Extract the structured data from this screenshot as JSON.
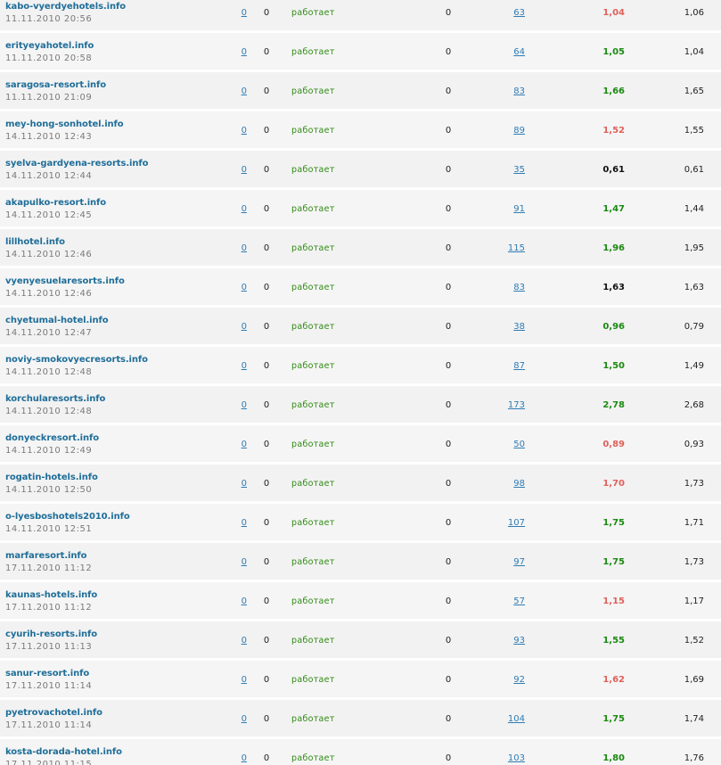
{
  "colors": {
    "green": "#1a8a10",
    "red": "#e0605a",
    "black": "#111111",
    "link": "#2f7cb4",
    "site": "#1f6e99",
    "status": "#2f8a12"
  },
  "rows": [
    {
      "site": "kabo-vyerdyehotels.info",
      "date": "11.11.2010 20:56",
      "links": "0",
      "zero1": "0",
      "status": "работает",
      "zero2": "0",
      "count": "63",
      "ratio": "1,04",
      "ratio_color": "red",
      "ratio2": "1,06"
    },
    {
      "site": "erityeyahotel.info",
      "date": "11.11.2010 20:58",
      "links": "0",
      "zero1": "0",
      "status": "работает",
      "zero2": "0",
      "count": "64",
      "ratio": "1,05",
      "ratio_color": "green",
      "ratio2": "1,04"
    },
    {
      "site": "saragosa-resort.info",
      "date": "11.11.2010 21:09",
      "links": "0",
      "zero1": "0",
      "status": "работает",
      "zero2": "0",
      "count": "83",
      "ratio": "1,66",
      "ratio_color": "green",
      "ratio2": "1,65"
    },
    {
      "site": "mey-hong-sonhotel.info",
      "date": "14.11.2010 12:43",
      "links": "0",
      "zero1": "0",
      "status": "работает",
      "zero2": "0",
      "count": "89",
      "ratio": "1,52",
      "ratio_color": "red",
      "ratio2": "1,55"
    },
    {
      "site": "syelva-gardyena-resorts.info",
      "date": "14.11.2010 12:44",
      "links": "0",
      "zero1": "0",
      "status": "работает",
      "zero2": "0",
      "count": "35",
      "ratio": "0,61",
      "ratio_color": "black",
      "ratio2": "0,61"
    },
    {
      "site": "akapulko-resort.info",
      "date": "14.11.2010 12:45",
      "links": "0",
      "zero1": "0",
      "status": "работает",
      "zero2": "0",
      "count": "91",
      "ratio": "1,47",
      "ratio_color": "green",
      "ratio2": "1,44"
    },
    {
      "site": "lillhotel.info",
      "date": "14.11.2010 12:46",
      "links": "0",
      "zero1": "0",
      "status": "работает",
      "zero2": "0",
      "count": "115",
      "ratio": "1,96",
      "ratio_color": "green",
      "ratio2": "1,95"
    },
    {
      "site": "vyenyesuelaresorts.info",
      "date": "14.11.2010 12:46",
      "links": "0",
      "zero1": "0",
      "status": "работает",
      "zero2": "0",
      "count": "83",
      "ratio": "1,63",
      "ratio_color": "black",
      "ratio2": "1,63"
    },
    {
      "site": "chyetumal-hotel.info",
      "date": "14.11.2010 12:47",
      "links": "0",
      "zero1": "0",
      "status": "работает",
      "zero2": "0",
      "count": "38",
      "ratio": "0,96",
      "ratio_color": "green",
      "ratio2": "0,79"
    },
    {
      "site": "noviy-smokovyecresorts.info",
      "date": "14.11.2010 12:48",
      "links": "0",
      "zero1": "0",
      "status": "работает",
      "zero2": "0",
      "count": "87",
      "ratio": "1,50",
      "ratio_color": "green",
      "ratio2": "1,49"
    },
    {
      "site": "korchularesorts.info",
      "date": "14.11.2010 12:48",
      "links": "0",
      "zero1": "0",
      "status": "работает",
      "zero2": "0",
      "count": "173",
      "ratio": "2,78",
      "ratio_color": "green",
      "ratio2": "2,68"
    },
    {
      "site": "donyeckresort.info",
      "date": "14.11.2010 12:49",
      "links": "0",
      "zero1": "0",
      "status": "работает",
      "zero2": "0",
      "count": "50",
      "ratio": "0,89",
      "ratio_color": "red",
      "ratio2": "0,93"
    },
    {
      "site": "rogatin-hotels.info",
      "date": "14.11.2010 12:50",
      "links": "0",
      "zero1": "0",
      "status": "работает",
      "zero2": "0",
      "count": "98",
      "ratio": "1,70",
      "ratio_color": "red",
      "ratio2": "1,73"
    },
    {
      "site": "o-lyesboshotels2010.info",
      "date": "14.11.2010 12:51",
      "links": "0",
      "zero1": "0",
      "status": "работает",
      "zero2": "0",
      "count": "107",
      "ratio": "1,75",
      "ratio_color": "green",
      "ratio2": "1,71"
    },
    {
      "site": "marfaresort.info",
      "date": "17.11.2010 11:12",
      "links": "0",
      "zero1": "0",
      "status": "работает",
      "zero2": "0",
      "count": "97",
      "ratio": "1,75",
      "ratio_color": "green",
      "ratio2": "1,73"
    },
    {
      "site": "kaunas-hotels.info",
      "date": "17.11.2010 11:12",
      "links": "0",
      "zero1": "0",
      "status": "работает",
      "zero2": "0",
      "count": "57",
      "ratio": "1,15",
      "ratio_color": "red",
      "ratio2": "1,17"
    },
    {
      "site": "cyurih-resorts.info",
      "date": "17.11.2010 11:13",
      "links": "0",
      "zero1": "0",
      "status": "работает",
      "zero2": "0",
      "count": "93",
      "ratio": "1,55",
      "ratio_color": "green",
      "ratio2": "1,52"
    },
    {
      "site": "sanur-resort.info",
      "date": "17.11.2010 11:14",
      "links": "0",
      "zero1": "0",
      "status": "работает",
      "zero2": "0",
      "count": "92",
      "ratio": "1,62",
      "ratio_color": "red",
      "ratio2": "1,69"
    },
    {
      "site": "pyetrovachotel.info",
      "date": "17.11.2010 11:14",
      "links": "0",
      "zero1": "0",
      "status": "работает",
      "zero2": "0",
      "count": "104",
      "ratio": "1,75",
      "ratio_color": "green",
      "ratio2": "1,74"
    },
    {
      "site": "kosta-dorada-hotel.info",
      "date": "17.11.2010 11:15",
      "links": "0",
      "zero1": "0",
      "status": "работает",
      "zero2": "0",
      "count": "103",
      "ratio": "1,80",
      "ratio_color": "green",
      "ratio2": "1,76"
    }
  ]
}
